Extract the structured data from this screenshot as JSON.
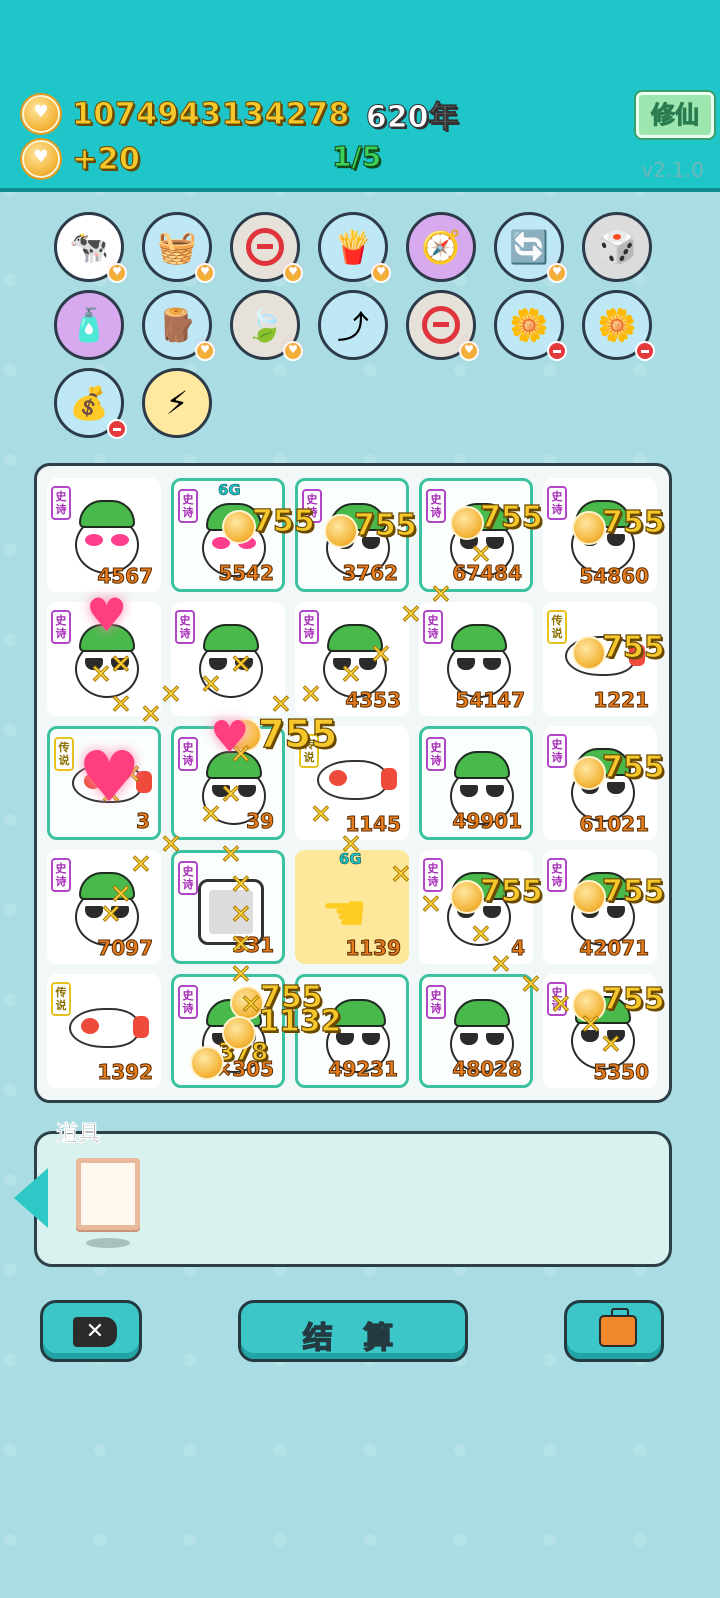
{
  "header": {
    "coins": "1074943134278",
    "years": "620年",
    "income": "+20",
    "progress": "1/5",
    "xiuxian_label": "修仙",
    "version": "v2.1.0"
  },
  "skills": [
    {
      "name": "cows-icon",
      "emoji": "🐄",
      "bg": "#ffffff",
      "badge": "heart"
    },
    {
      "name": "fruit-basket-icon",
      "emoji": "🧺",
      "bg": "#bfe8f6",
      "badge": "heart"
    },
    {
      "name": "no-entry-icon",
      "emoji": "",
      "bg": "#e6e1d9",
      "badge": "heart"
    },
    {
      "name": "fries-icon",
      "emoji": "🍟",
      "bg": "#bfe8f6",
      "badge": "heart"
    },
    {
      "name": "compass-icon",
      "emoji": "🧭",
      "bg": "#d7a9ee",
      "badge": ""
    },
    {
      "name": "refresh-icon",
      "emoji": "🔄",
      "bg": "#bfe8f6",
      "badge": "heart"
    },
    {
      "name": "dice-icon",
      "emoji": "🎲",
      "bg": "#dcdcdc",
      "badge": ""
    },
    {
      "name": "pump-icon",
      "emoji": "🧴",
      "bg": "#d7a9ee",
      "badge": ""
    },
    {
      "name": "tree-stump-icon",
      "emoji": "🪵",
      "bg": "#bfe8f6",
      "badge": "heart"
    },
    {
      "name": "leaf-icon",
      "emoji": "🍃",
      "bg": "#e6e1d9",
      "badge": "heart"
    },
    {
      "name": "arrow-up-icon",
      "emoji": "⤴",
      "bg": "#bfe8f6",
      "badge": ""
    },
    {
      "name": "no-entry-icon",
      "emoji": "",
      "bg": "#e6e1d9",
      "badge": "heart"
    },
    {
      "name": "flower-pot-icon",
      "emoji": "🌼",
      "bg": "#bfe8f6",
      "badge": "minus"
    },
    {
      "name": "flower-pot-icon",
      "emoji": "🌼",
      "bg": "#bfe8f6",
      "badge": "minus"
    },
    {
      "name": "sack-icon",
      "emoji": "💰",
      "bg": "#bfe8f6",
      "badge": "minus"
    },
    {
      "name": "lightning-icon",
      "emoji": "⚡",
      "bg": "#ffe8a0",
      "badge": ""
    }
  ],
  "board": [
    [
      {
        "tag": "史诗",
        "type": "face",
        "glasses": "pink",
        "score": "4567",
        "hl": false
      },
      {
        "tag": "史诗",
        "type": "face",
        "glasses": "pink",
        "score": "5542",
        "hl": true,
        "g6": "6G"
      },
      {
        "tag": "史诗",
        "type": "face",
        "glasses": "dark",
        "score": "3762",
        "hl": true
      },
      {
        "tag": "史诗",
        "type": "face",
        "glasses": "dark",
        "score": "67484",
        "hl": true
      },
      {
        "tag": "史诗",
        "type": "face",
        "glasses": "dark",
        "score": "54860",
        "hl": false
      }
    ],
    [
      {
        "tag": "史诗",
        "type": "face",
        "glasses": "dark",
        "score": "",
        "hl": false
      },
      {
        "tag": "史诗",
        "type": "face",
        "glasses": "dark",
        "score": "",
        "hl": false
      },
      {
        "tag": "史诗",
        "type": "face",
        "glasses": "dark",
        "score": "4353",
        "hl": false
      },
      {
        "tag": "史诗",
        "type": "face",
        "glasses": "dark",
        "score": "54147",
        "hl": false
      },
      {
        "tag": "传说",
        "type": "fish",
        "score": "1221",
        "hl": false
      }
    ],
    [
      {
        "tag": "传说",
        "type": "fish",
        "score": "3",
        "hl": true
      },
      {
        "tag": "史诗",
        "type": "face",
        "glasses": "dark",
        "score": "39",
        "hl": true
      },
      {
        "tag": "传说",
        "type": "fish",
        "score": "1145",
        "hl": false
      },
      {
        "tag": "史诗",
        "type": "face",
        "glasses": "dark",
        "score": "49901",
        "hl": true
      },
      {
        "tag": "史诗",
        "type": "face",
        "glasses": "dark",
        "score": "61021",
        "hl": false
      }
    ],
    [
      {
        "tag": "史诗",
        "type": "face",
        "glasses": "dark",
        "score": "7097",
        "hl": false
      },
      {
        "tag": "史诗",
        "type": "tv",
        "score": "331",
        "hl": true
      },
      {
        "tag": "",
        "type": "hand",
        "score": "1139",
        "hl": false,
        "yellow": true,
        "g6": "6G"
      },
      {
        "tag": "史诗",
        "type": "face",
        "glasses": "dark",
        "score": "4",
        "hl": false
      },
      {
        "tag": "史诗",
        "type": "face",
        "glasses": "dark",
        "score": "42071",
        "hl": false
      }
    ],
    [
      {
        "tag": "传说",
        "type": "fish",
        "score": "1392",
        "hl": false
      },
      {
        "tag": "史诗",
        "type": "face",
        "glasses": "dark",
        "score": "×305",
        "hl": true
      },
      {
        "tag": "",
        "type": "face",
        "glasses": "dark",
        "score": "49231",
        "hl": true
      },
      {
        "tag": "史诗",
        "type": "face",
        "glasses": "dark",
        "score": "48028",
        "hl": true
      },
      {
        "tag": "史诗",
        "type": "face",
        "glasses": "dark",
        "score": "5350",
        "hl": false
      }
    ]
  ],
  "effects": {
    "gain": "755",
    "gain2": "1132",
    "gain3": "378"
  },
  "items": {
    "label": "道具"
  },
  "buttons": {
    "settle": "结 算"
  }
}
